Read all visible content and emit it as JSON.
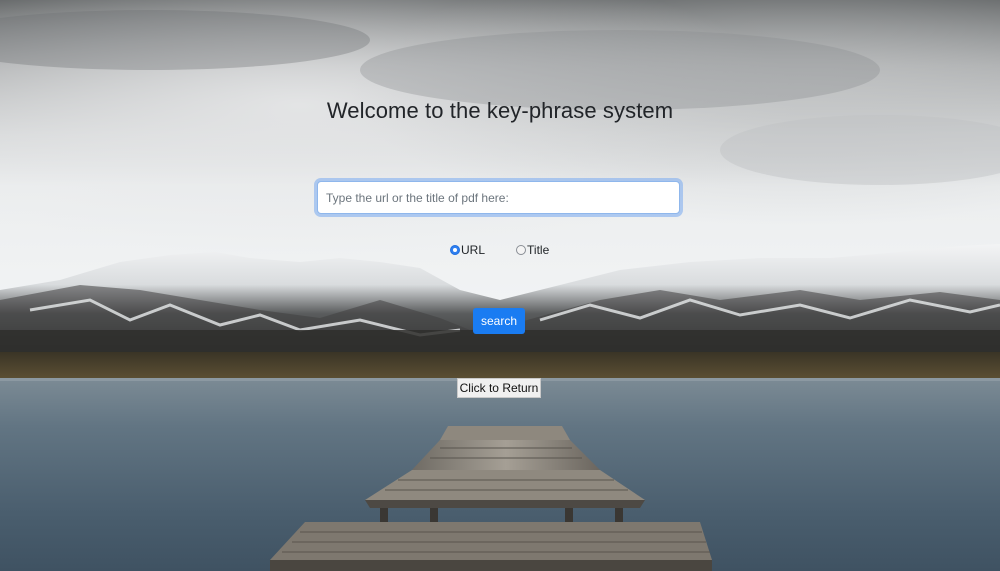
{
  "page": {
    "title": "Welcome to the key-phrase system"
  },
  "search": {
    "placeholder": "Type the url or the title of pdf here:",
    "value": ""
  },
  "search_type": {
    "options": [
      {
        "label": "URL",
        "checked": true
      },
      {
        "label": "Title",
        "checked": false
      }
    ]
  },
  "actions": {
    "search_label": "search",
    "return_label": "Click to Return"
  },
  "background": {
    "scene": "snowy-mountains-lake-pier",
    "accent_color": "#1a7cf2"
  }
}
